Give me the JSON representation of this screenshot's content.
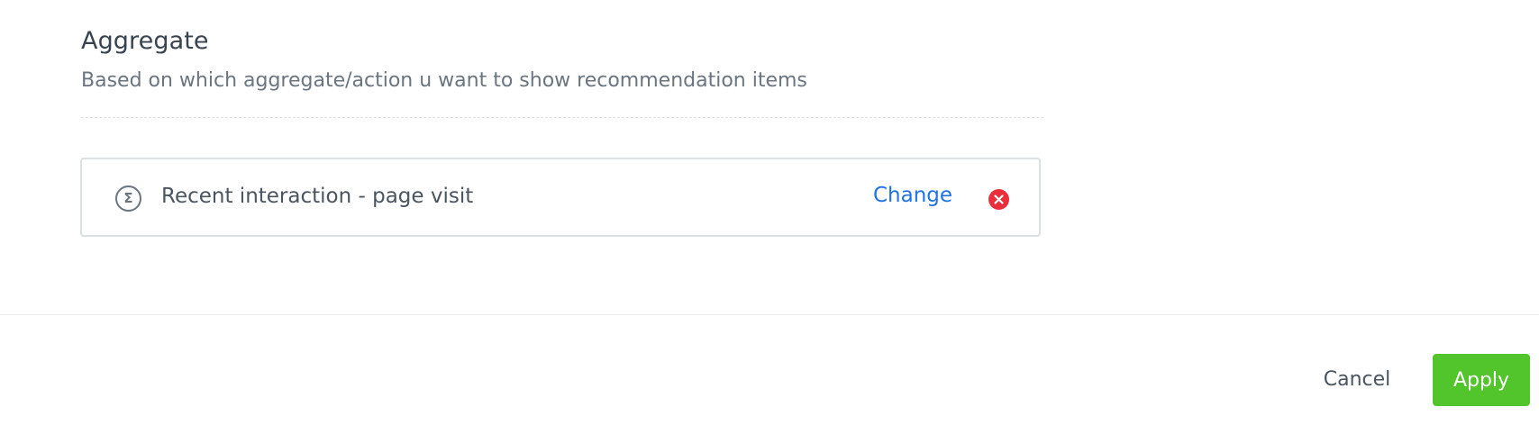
{
  "aggregate_section": {
    "title": "Aggregate",
    "description": "Based on which aggregate/action u want to show recommendation items"
  },
  "selected_aggregate": {
    "icon": "sigma-icon",
    "icon_glyph": "Σ",
    "label": "Recent interaction - page visit",
    "change_label": "Change",
    "remove_icon": "close-circle-icon"
  },
  "footer": {
    "cancel_label": "Cancel",
    "apply_label": "Apply"
  },
  "colors": {
    "link": "#1f73e8",
    "remove": "#eb2f3a",
    "apply": "#52c42c"
  }
}
